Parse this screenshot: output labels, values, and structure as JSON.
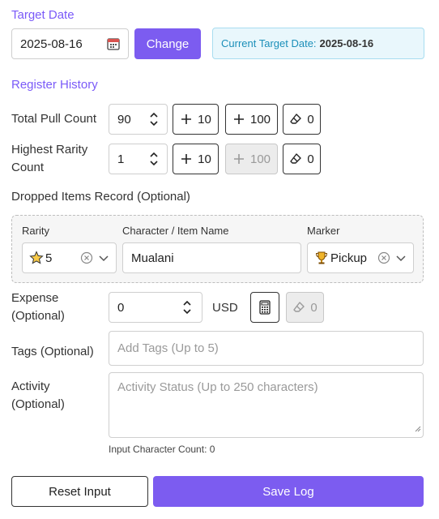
{
  "target_date": {
    "section_title": "Target Date",
    "date_value": "2025-08-16",
    "change_label": "Change",
    "current_label": "Current Target Date:",
    "current_value": "2025-08-16"
  },
  "register": {
    "section_title": "Register History",
    "total_pull": {
      "label": "Total Pull Count",
      "value": "90",
      "btn_10": "10",
      "btn_100": "100",
      "btn_reset": "0"
    },
    "highest_rarity": {
      "label_line1": "Highest Rarity",
      "label_line2": "Count",
      "value": "1",
      "btn_10": "10",
      "btn_100": "100",
      "btn_reset": "0"
    }
  },
  "dropped": {
    "title": "Dropped Items Record (Optional)",
    "rarity_header": "Rarity",
    "name_header": "Character / Item Name",
    "marker_header": "Marker",
    "rarity_value": "5",
    "name_value": "Mualani",
    "marker_value": "Pickup"
  },
  "expense": {
    "label_line1": "Expense",
    "label_line2": "(Optional)",
    "value": "0",
    "currency": "USD",
    "reset_value": "0"
  },
  "tags": {
    "label": "Tags (Optional)",
    "placeholder": "Add Tags (Up to 5)"
  },
  "activity": {
    "label_line1": "Activity",
    "label_line2": "(Optional)",
    "placeholder": "Activity Status (Up to 250 characters)",
    "char_count_label": "Input Character Count: 0"
  },
  "footer": {
    "reset_label": "Reset Input",
    "save_label": "Save Log"
  },
  "colors": {
    "accent": "#7c5cf0",
    "info_bg": "#e9f7fc",
    "info_text": "#1b8fb9"
  }
}
